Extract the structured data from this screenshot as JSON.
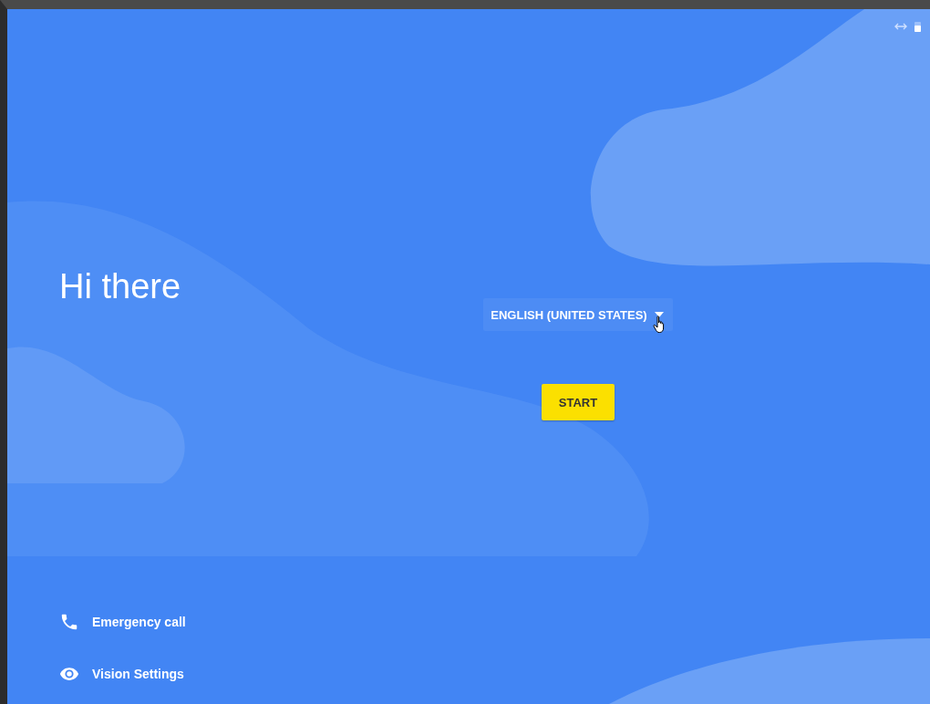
{
  "title": "Hi there",
  "language": {
    "label": "ENGLISH (UNITED STATES)"
  },
  "start_button": "START",
  "links": [
    {
      "kind": "phone",
      "label": "Emergency call"
    },
    {
      "kind": "eye",
      "label": "Vision Settings"
    }
  ]
}
